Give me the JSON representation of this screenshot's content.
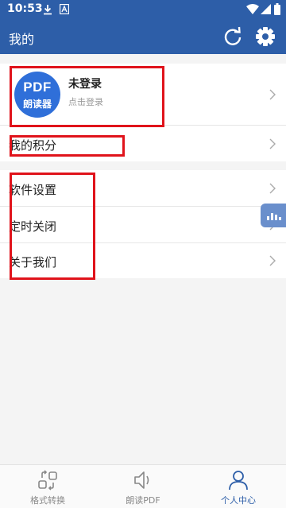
{
  "status_bar": {
    "time": "10:53"
  },
  "header": {
    "title": "我的"
  },
  "profile": {
    "avatar_line1": "PDF",
    "avatar_line2": "朗读器",
    "name": "未登录",
    "subtitle": "点击登录"
  },
  "points": {
    "label": "我的积分"
  },
  "menu": [
    {
      "label": "软件设置"
    },
    {
      "label": "定时关闭"
    },
    {
      "label": "关于我们"
    }
  ],
  "bottom_nav": [
    {
      "label": "格式转换",
      "icon": "convert-icon",
      "active": false
    },
    {
      "label": "朗读PDF",
      "icon": "speaker-icon",
      "active": false
    },
    {
      "label": "个人中心",
      "icon": "person-icon",
      "active": true
    }
  ],
  "colors": {
    "primary": "#2d5ea8",
    "annotation": "#e0131b"
  }
}
